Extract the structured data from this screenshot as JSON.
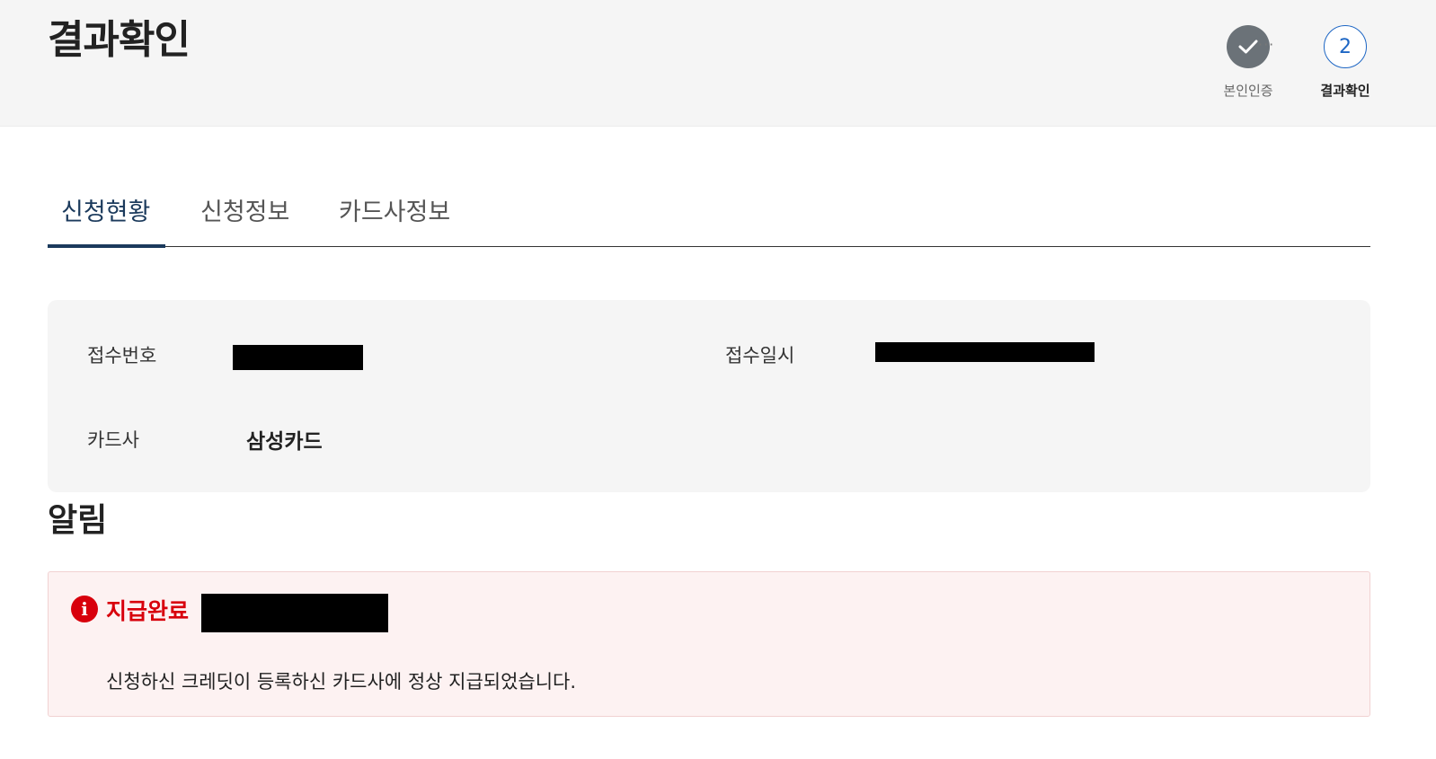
{
  "header": {
    "title": "결과확인",
    "steps": [
      {
        "label": "본인인증",
        "status": "done",
        "icon": "check-icon"
      },
      {
        "label": "결과확인",
        "number": "2",
        "status": "current"
      }
    ],
    "separator": "···"
  },
  "tabs": [
    {
      "label": "신청현황",
      "active": true
    },
    {
      "label": "신청정보",
      "active": false
    },
    {
      "label": "카드사정보",
      "active": false
    }
  ],
  "info": {
    "receipt_number_label": "접수번호",
    "receipt_datetime_label": "접수일시",
    "card_company_label": "카드사",
    "card_company_value": "삼성카드"
  },
  "notice": {
    "title": "알림",
    "status": "지급완료",
    "icon": "info-icon",
    "message": "신청하신 크레딧이 등록하신 카드사에 정상 지급되었습니다."
  },
  "colors": {
    "primary": "#1b3a5c",
    "step_current": "#1d66c4",
    "alert": "#d8000c",
    "alert_bg": "#fdf2f2"
  }
}
